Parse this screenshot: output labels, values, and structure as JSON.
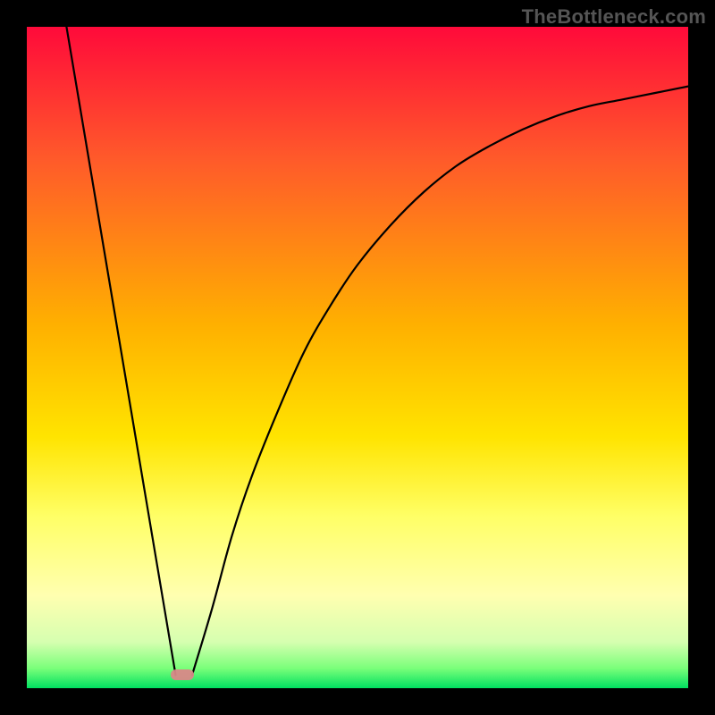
{
  "watermark": "TheBottleneck.com",
  "chart_data": {
    "type": "line",
    "title": "",
    "xlabel": "",
    "ylabel": "",
    "xlim": [
      0,
      100
    ],
    "ylim": [
      0,
      100
    ],
    "gradient_stops": [
      {
        "pct": 0,
        "color": "#ff0a3a"
      },
      {
        "pct": 20,
        "color": "#ff5a2a"
      },
      {
        "pct": 45,
        "color": "#ffb000"
      },
      {
        "pct": 62,
        "color": "#ffe400"
      },
      {
        "pct": 74,
        "color": "#ffff66"
      },
      {
        "pct": 86,
        "color": "#ffffb0"
      },
      {
        "pct": 93,
        "color": "#d6ffb0"
      },
      {
        "pct": 97,
        "color": "#7aff7a"
      },
      {
        "pct": 100,
        "color": "#00e060"
      }
    ],
    "series": [
      {
        "name": "left-line",
        "x": [
          6,
          22.5
        ],
        "y": [
          100,
          2
        ]
      },
      {
        "name": "right-curve",
        "x": [
          25,
          28,
          31,
          34,
          38,
          42,
          46,
          50,
          55,
          60,
          65,
          70,
          75,
          80,
          85,
          90,
          95,
          100
        ],
        "y": [
          2,
          12,
          23,
          32,
          42,
          51,
          58,
          64,
          70,
          75,
          79,
          82,
          84.5,
          86.5,
          88,
          89,
          90,
          91
        ]
      }
    ],
    "marker": {
      "x": 23.5,
      "y": 2
    }
  }
}
